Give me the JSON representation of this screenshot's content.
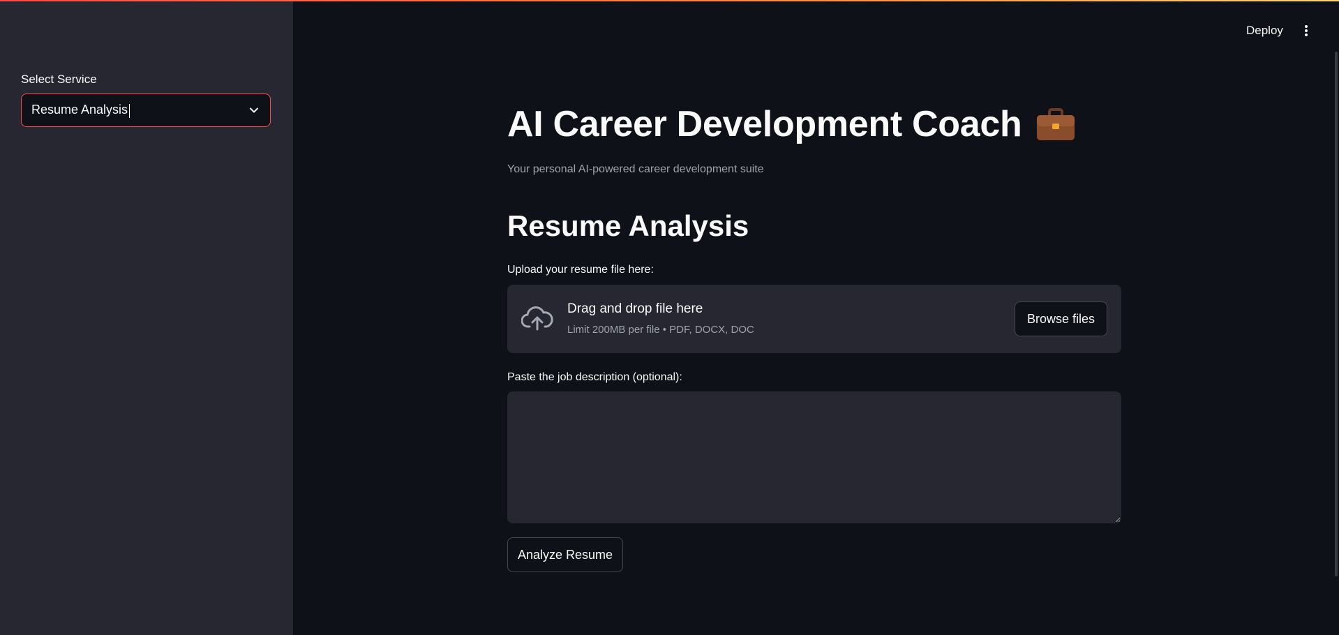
{
  "sidebar": {
    "select_label": "Select Service",
    "select_value": "Resume Analysis"
  },
  "header": {
    "deploy_label": "Deploy",
    "menu_icon": "more-vertical-icon"
  },
  "main": {
    "title": "AI Career Development Coach",
    "title_icon": "briefcase-icon",
    "subtitle": "Your personal AI-powered career development suite",
    "section_title": "Resume Analysis",
    "upload": {
      "label": "Upload your resume file here:",
      "icon": "cloud-upload-icon",
      "drop_title": "Drag and drop file here",
      "limit_text": "Limit 200MB per file • PDF, DOCX, DOC",
      "browse_label": "Browse files"
    },
    "job_description": {
      "label": "Paste the job description (optional):",
      "value": ""
    },
    "analyze_label": "Analyze Resume"
  },
  "colors": {
    "background": "#0e1117",
    "sidebar": "#262730",
    "accent": "#ff4b4b",
    "muted_text": "#9ea2ad"
  }
}
